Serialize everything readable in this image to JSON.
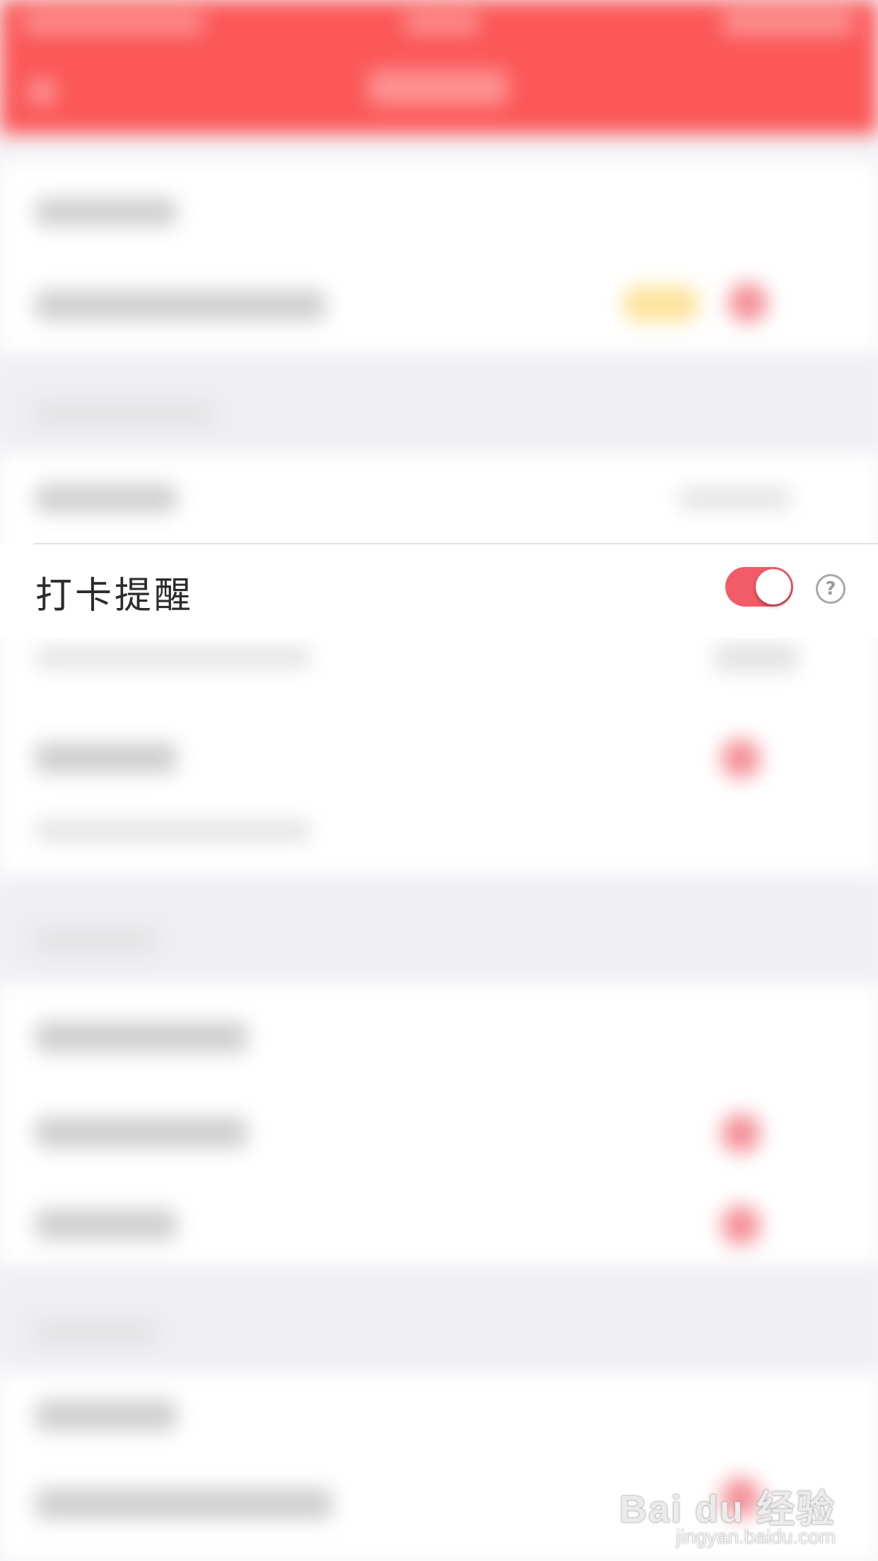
{
  "reminder": {
    "label": "打卡提醒",
    "toggle_on": true,
    "help_symbol": "?"
  },
  "watermark": {
    "brand": "Bai du 经验",
    "url": "jingyan.baidu.com"
  },
  "colors": {
    "header": "#fb5757",
    "toggle_on": "#f25b68",
    "page_bg": "#f4f4f7"
  }
}
